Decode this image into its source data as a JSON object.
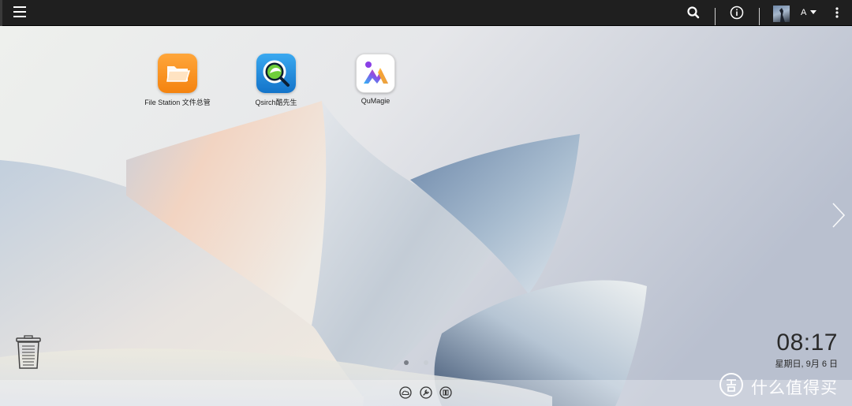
{
  "topbar": {
    "menu_icon": "hamburger-menu-icon",
    "search_icon": "search-icon",
    "info_icon": "info-icon",
    "user_initial": "A",
    "user_dropdown_icon": "caret-down-icon",
    "more_icon": "kebab-more-icon",
    "bg_color": "#1f1f1f"
  },
  "desktop": {
    "apps": [
      {
        "label": "File Station 文件总管",
        "icon": "folder-icon",
        "color": "#f7941d"
      },
      {
        "label": "Qsirch酷先生",
        "icon": "qsirch-icon",
        "color": "#1e90ff"
      },
      {
        "label": "QuMagie",
        "icon": "qumagie-icon",
        "color": "#ffffff"
      }
    ],
    "trash_icon": "trash-icon",
    "next_page_icon": "chevron-right-icon",
    "page_indicator": {
      "total": 2,
      "active": 1
    }
  },
  "clock": {
    "time": "08:17",
    "date": "星期日, 9月 6 日"
  },
  "dock": {
    "items": [
      "cloud-icon",
      "wrench-icon",
      "apps-icon"
    ]
  },
  "watermark": {
    "logo": "zhi-badge-icon",
    "text": "什么值得买"
  }
}
